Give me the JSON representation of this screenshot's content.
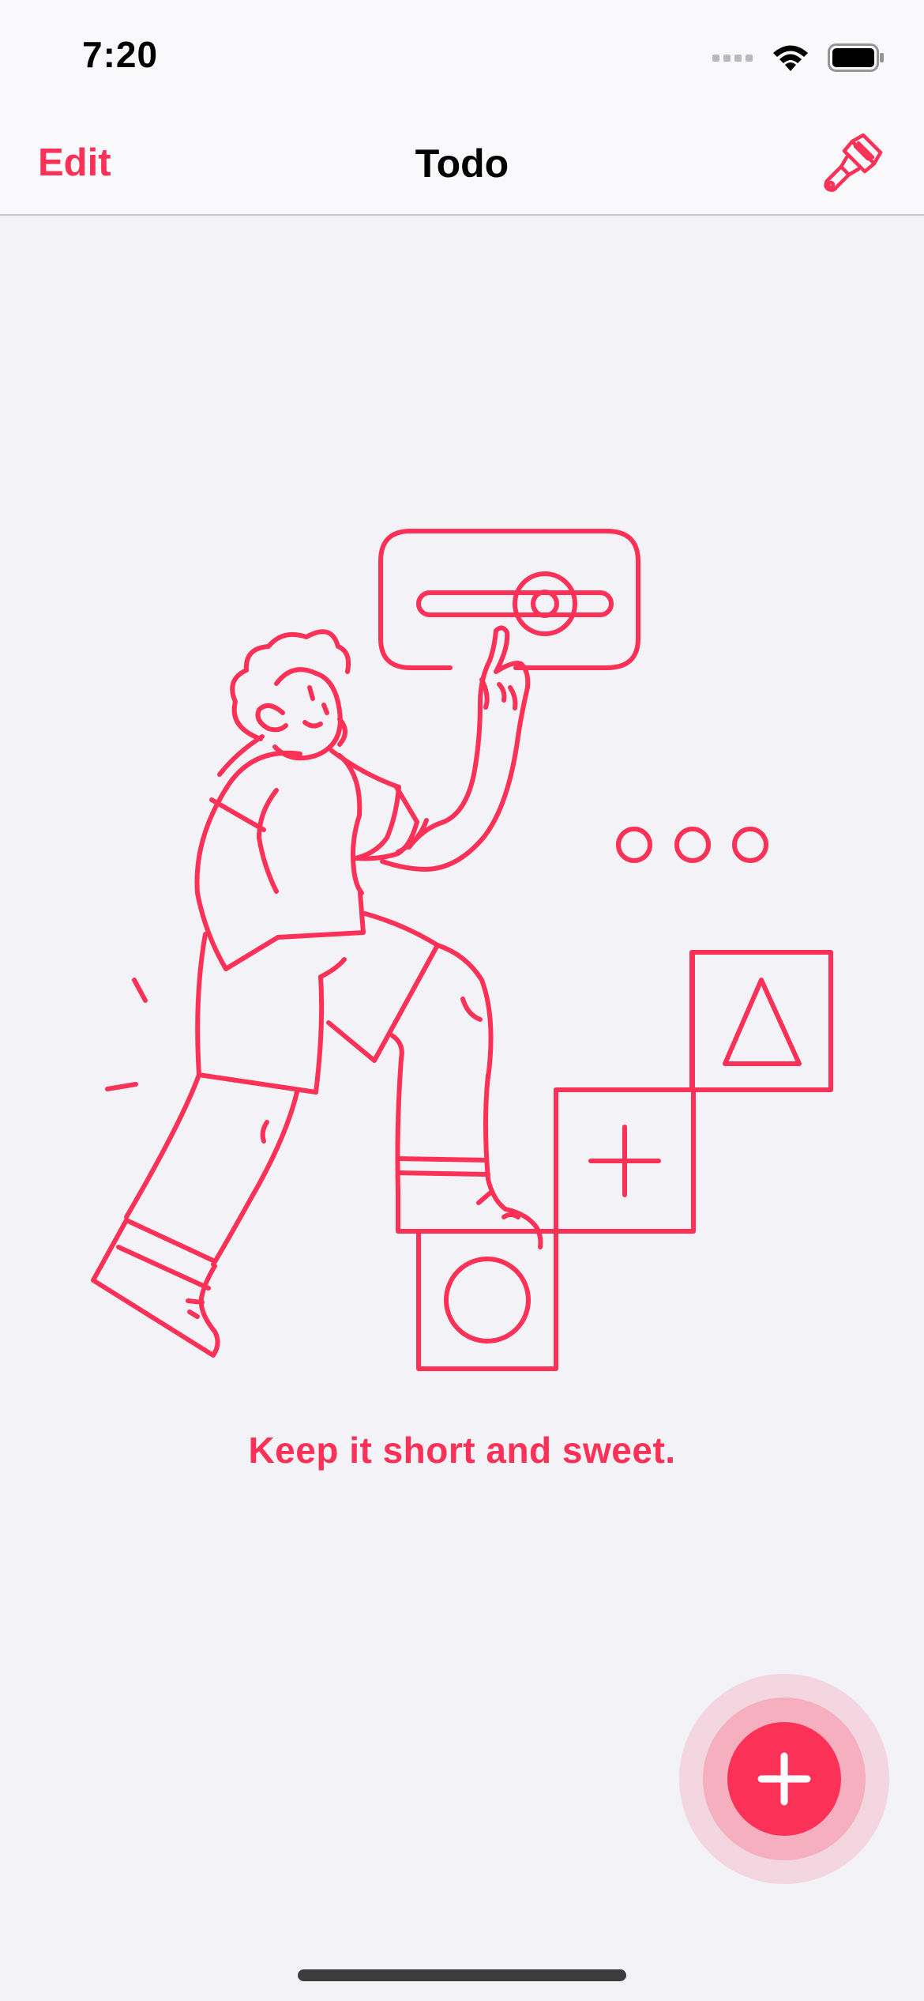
{
  "status_bar": {
    "time": "7:20",
    "icons": [
      "cellular-signal-icon",
      "wifi-icon",
      "battery-icon"
    ]
  },
  "nav": {
    "edit_label": "Edit",
    "title": "Todo",
    "theme_icon": "paintbrush-icon"
  },
  "empty_state": {
    "illustration": "person-pressing-slider-illustration",
    "message": "Keep it short and sweet."
  },
  "fab": {
    "icon": "plus-icon"
  },
  "colors": {
    "accent": "#fc3158",
    "background": "#f2f2f7",
    "nav_background": "#f9f9fb"
  }
}
